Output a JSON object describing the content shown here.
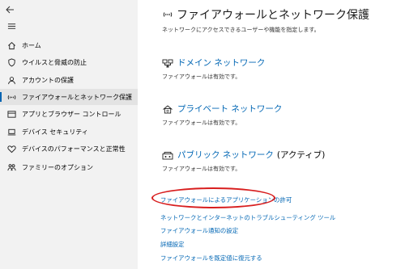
{
  "sidebar": {
    "home": {
      "label": "ホーム",
      "icon": "home-icon"
    },
    "items": [
      {
        "label": "ウイルスと脅威の防止",
        "icon": "shield-icon"
      },
      {
        "label": "アカウントの保護",
        "icon": "person-icon"
      },
      {
        "label": "ファイアウォールとネットワーク保護",
        "icon": "wifi-icon",
        "active": true
      },
      {
        "label": "アプリとブラウザー コントロール",
        "icon": "app-window-icon"
      },
      {
        "label": "デバイス セキュリティ",
        "icon": "laptop-icon"
      },
      {
        "label": "デバイスのパフォーマンスと正常性",
        "icon": "heart-icon"
      },
      {
        "label": "ファミリーのオプション",
        "icon": "family-icon"
      }
    ]
  },
  "header": {
    "title": "ファイアウォールとネットワーク保護",
    "description": "ネットワークにアクセスできるユーザーや機能を指定します。"
  },
  "networks": [
    {
      "label": "ドメイン ネットワーク",
      "status": "ファイアウォールは有効です。",
      "icon": "domain-network-icon"
    },
    {
      "label": "プライベート ネットワーク",
      "status": "ファイアウォールは有効です。",
      "icon": "private-network-icon"
    },
    {
      "label": "パブリック ネットワーク",
      "active_tag": "(アクティブ)",
      "status": "ファイアウォールは有効です。",
      "icon": "public-network-icon"
    }
  ],
  "links": [
    "ファイアウォールによるアプリケーションの許可",
    "ネットワークとインターネットのトラブルシューティング ツール",
    "ファイアウォール通知の設定",
    "詳細設定",
    "ファイアウォールを既定値に復元する"
  ],
  "colors": {
    "accent": "#0066b4",
    "highlight": "#d81e1e"
  }
}
